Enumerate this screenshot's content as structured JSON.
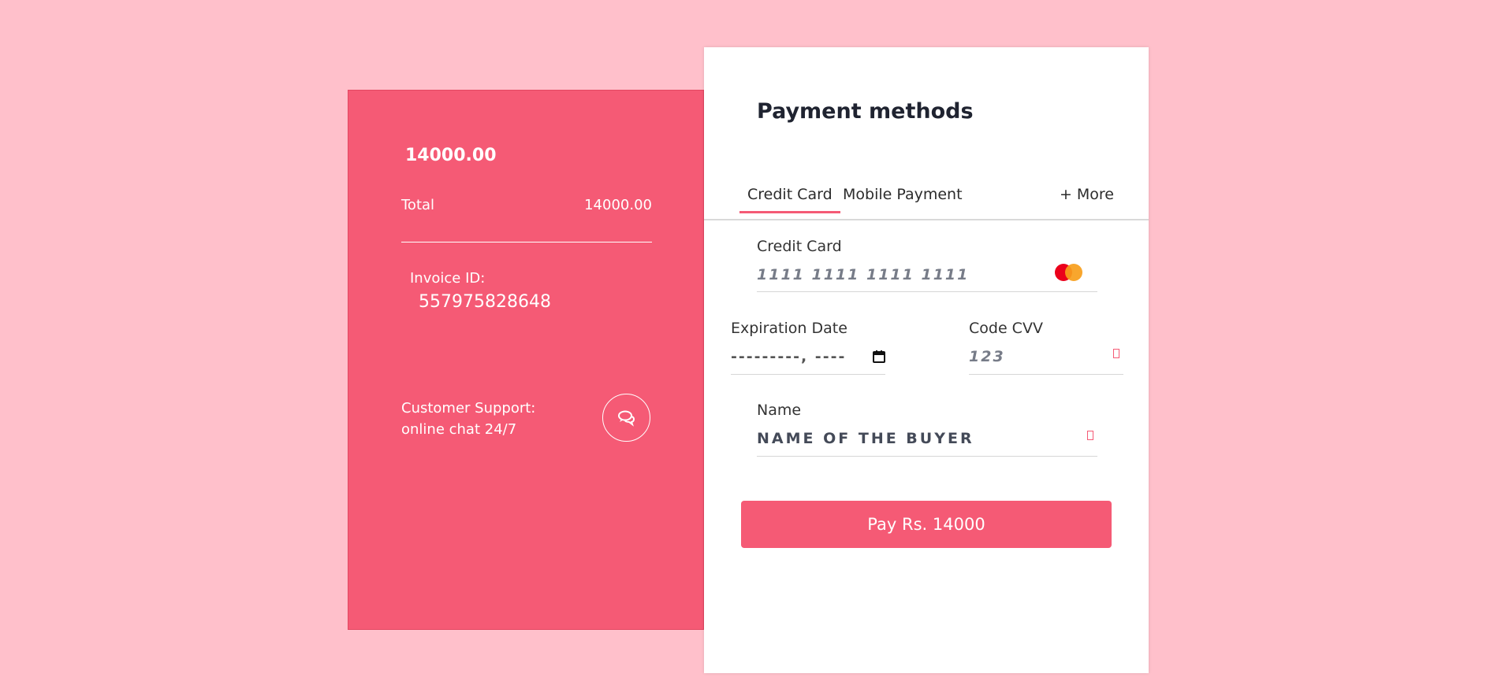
{
  "summary": {
    "amount": "14000.00",
    "total_label": "Total",
    "total_value": "14000.00",
    "invoice_label": "Invoice ID:",
    "invoice_id": "557975828648",
    "support_line1": "Customer Support:",
    "support_line2": "online chat 24/7",
    "chat_icon": "chat-bubbles-icon"
  },
  "payment": {
    "title": "Payment methods",
    "tabs": [
      {
        "label": "Credit Card",
        "active": true
      },
      {
        "label": "Mobile Payment",
        "active": false
      },
      {
        "label": "+ More",
        "active": false
      }
    ],
    "card": {
      "label": "Credit Card",
      "placeholder": "1111 1111 1111 1111",
      "value": "",
      "brand_icon": "mastercard-icon"
    },
    "expiration": {
      "label": "Expiration Date",
      "display": "---------, ----",
      "icon": "calendar-icon"
    },
    "cvv": {
      "label": "Code CVV",
      "placeholder": "123",
      "value": ""
    },
    "name": {
      "label": "Name",
      "value": "NAME OF THE BUYER"
    },
    "pay_button": "Pay Rs. 14000"
  },
  "colors": {
    "background": "#ffc0cb",
    "accent": "#f55a75"
  }
}
